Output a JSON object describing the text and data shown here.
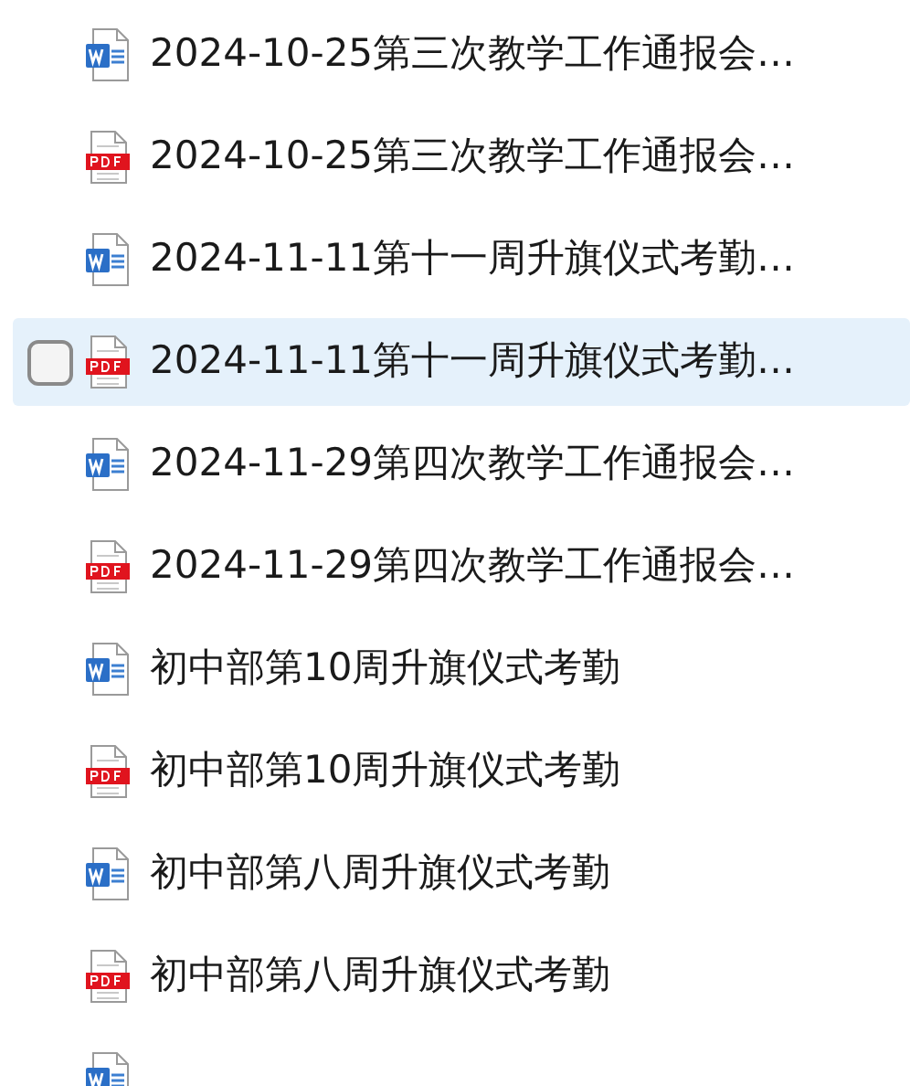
{
  "files": [
    {
      "kind": "word",
      "name": "2024-10-25第三次教学工作通报会…",
      "selected": false
    },
    {
      "kind": "pdf",
      "name": "2024-10-25第三次教学工作通报会…",
      "selected": false
    },
    {
      "kind": "word",
      "name": "2024-11-11第十一周升旗仪式考勤…",
      "selected": false
    },
    {
      "kind": "pdf",
      "name": "2024-11-11第十一周升旗仪式考勤…",
      "selected": true
    },
    {
      "kind": "word",
      "name": "2024-11-29第四次教学工作通报会…",
      "selected": false
    },
    {
      "kind": "pdf",
      "name": "2024-11-29第四次教学工作通报会…",
      "selected": false
    },
    {
      "kind": "word",
      "name": "初中部第10周升旗仪式考勤",
      "selected": false
    },
    {
      "kind": "pdf",
      "name": "初中部第10周升旗仪式考勤",
      "selected": false
    },
    {
      "kind": "word",
      "name": "初中部第八周升旗仪式考勤",
      "selected": false
    },
    {
      "kind": "pdf",
      "name": "初中部第八周升旗仪式考勤",
      "selected": false
    },
    {
      "kind": "word",
      "selected": false
    }
  ]
}
